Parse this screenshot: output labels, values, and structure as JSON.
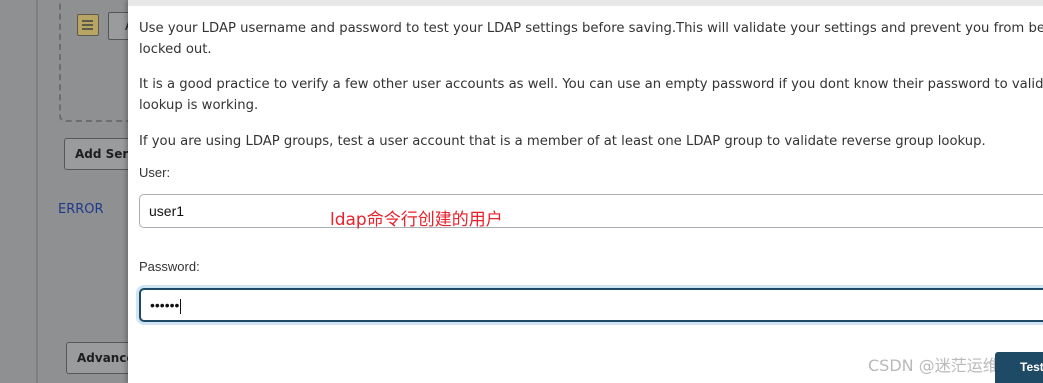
{
  "background": {
    "add_server_label": "Add Serv",
    "advanced_label": "Advance",
    "error_label": "ERROR",
    "small_box_text": "A"
  },
  "dialog": {
    "intro_lines": [
      "Use your LDAP username and password to test your LDAP settings before saving.This will validate your settings and prevent you from being accidentally",
      "locked out."
    ],
    "practice_lines": [
      "It is a good practice to verify a few other user accounts as well. You can use an empty password if you dont know their password to validate that user",
      "lookup is working."
    ],
    "groups_line": "If you are using LDAP groups, test a user account that is a member of at least one LDAP group to validate reverse group lookup.",
    "user_label": "User:",
    "user_value": "user1",
    "password_label": "Password:",
    "password_value": "••••••",
    "test_button_label": "Test"
  },
  "annotation": {
    "text": "ldap命令行创建的用户",
    "color": "#e8212b"
  },
  "watermark": "CSDN @迷茫运维路",
  "colors": {
    "accent": "#1f4a66",
    "focus_ring": "#cfe5f3",
    "error_link": "#1f3a8a"
  }
}
